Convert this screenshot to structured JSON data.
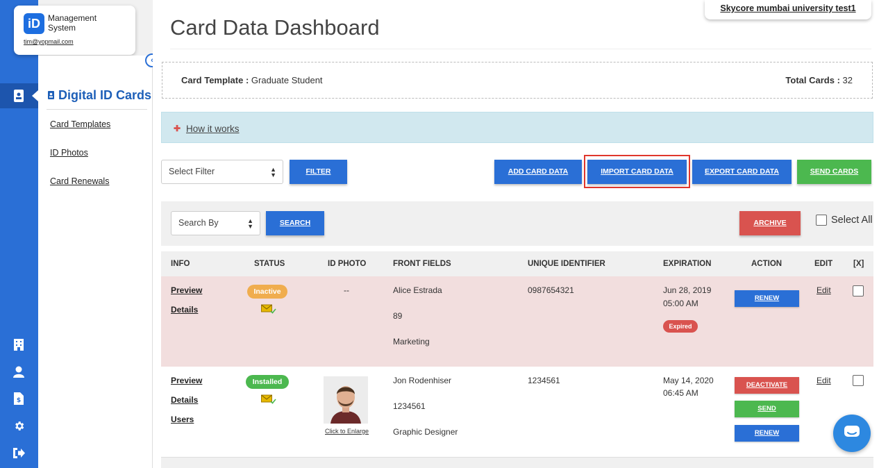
{
  "app": {
    "logo_text": "iD",
    "name": "Management System",
    "email": "tim@yopmail.com",
    "org": "Skycore mumbai university test1"
  },
  "rail": {
    "icons": [
      "id-card-icon",
      "building-icon",
      "user-icon",
      "invoice-icon",
      "gear-icon",
      "logout-icon"
    ]
  },
  "sidenav": {
    "title": "Digital ID Cards",
    "items": [
      "Card Templates",
      "ID Photos",
      "Card Renewals"
    ]
  },
  "page": {
    "title": "Card Data Dashboard"
  },
  "template": {
    "label": "Card Template :",
    "value": "Graduate Student",
    "total_label": "Total Cards :",
    "total_value": "32"
  },
  "how": {
    "label": "How it works"
  },
  "toolbar": {
    "filter_placeholder": "Select Filter",
    "filter_button": "FILTER",
    "add": "ADD CARD DATA",
    "import": "IMPORT CARD DATA",
    "export": "EXPORT CARD DATA",
    "send": "SEND CARDS"
  },
  "search": {
    "by_placeholder": "Search By",
    "button": "SEARCH",
    "archive": "ARCHIVE",
    "select_all": "Select All"
  },
  "table": {
    "headers": [
      "INFO",
      "STATUS",
      "ID PHOTO",
      "FRONT FIELDS",
      "UNIQUE IDENTIFIER",
      "EXPIRATION",
      "ACTION",
      "EDIT",
      "[X]"
    ],
    "rows": [
      {
        "links": [
          "Preview",
          "Details"
        ],
        "status": "Inactive",
        "photo": "--",
        "fields": [
          "Alice Estrada",
          "89",
          "Marketing"
        ],
        "uid": "0987654321",
        "exp_date": "Jun 28, 2019",
        "exp_time": "05:00 AM",
        "exp_badge": "Expired",
        "actions": [
          "RENEW"
        ],
        "edit": "Edit"
      },
      {
        "links": [
          "Preview",
          "Details",
          "Users"
        ],
        "status": "Installed",
        "photo_caption": "Click to Enlarge",
        "fields": [
          "Jon Rodenhiser",
          "1234561",
          "Graphic Designer"
        ],
        "uid": "1234561",
        "exp_date": "May 14, 2020",
        "exp_time": "06:45 AM",
        "actions": [
          "DEACTIVATE",
          "SEND",
          "RENEW"
        ],
        "edit": "Edit"
      }
    ]
  },
  "colors": {
    "primary": "#2a6fd6",
    "success": "#4cb84f",
    "danger": "#d9534f",
    "warning": "#f0ad4e",
    "expired_row": "#f2dede"
  }
}
